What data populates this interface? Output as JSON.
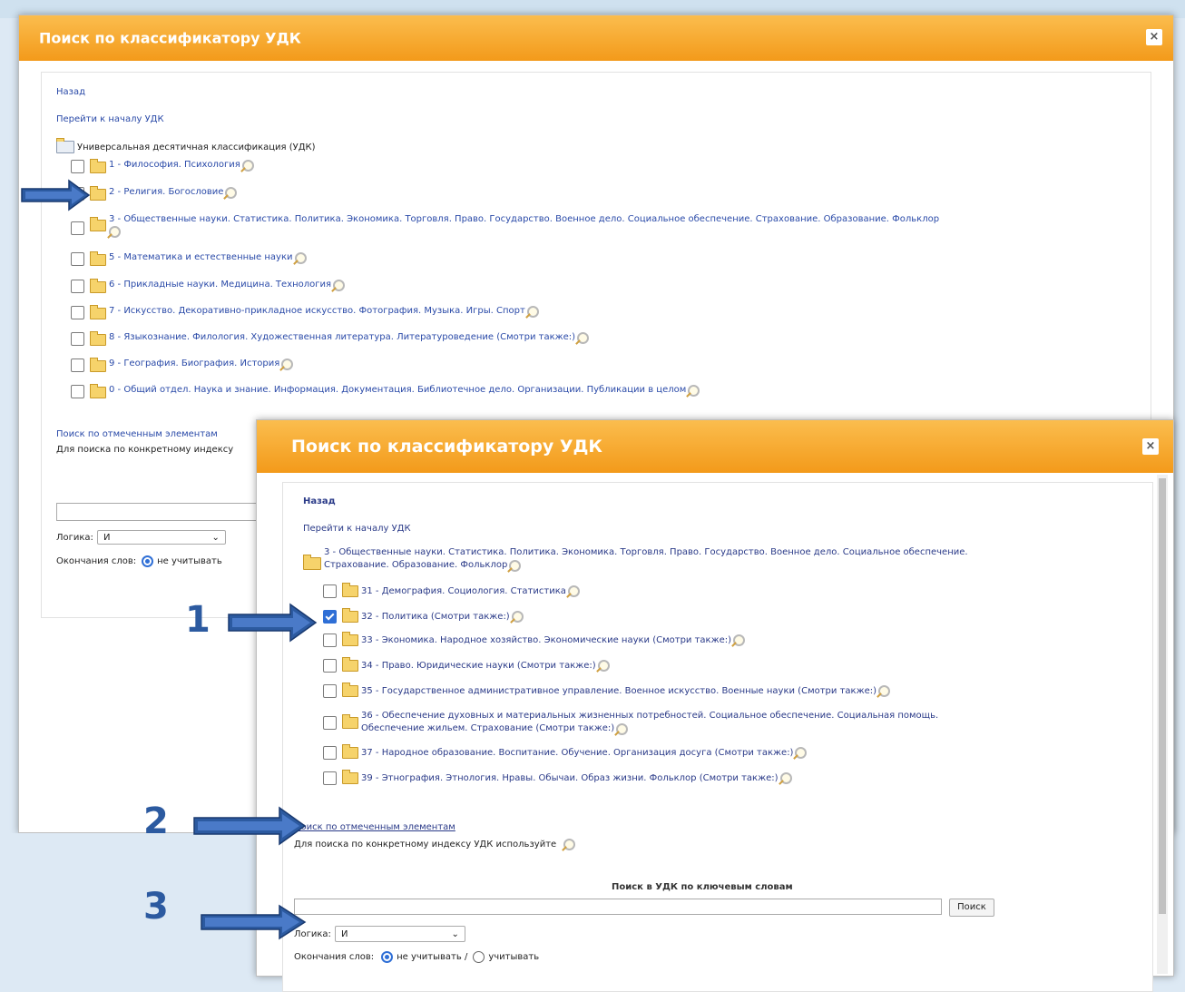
{
  "dialog1": {
    "title": "Поиск по классификатору УДК",
    "close_label": "×",
    "back_link": "Назад",
    "goto_start_link": "Перейти к началу УДК",
    "root_label": "Универсальная десятичная классификация (УДК)",
    "items": [
      {
        "label": "1 - Философия. Психология"
      },
      {
        "label": "2 - Религия. Богословие"
      },
      {
        "label": "3 - Общественные науки. Статистика. Политика. Экономика. Торговля. Право. Государство. Военное дело. Социальное обеспечение. Страхование. Образование. Фольклор"
      },
      {
        "label": "5 - Математика и естественные науки"
      },
      {
        "label": "6 - Прикладные науки. Медицина. Технология"
      },
      {
        "label": "7 - Искусство. Декоративно-прикладное искусство. Фотография. Музыка. Игры. Спорт"
      },
      {
        "label": "8 - Языкознание. Филология. Художественная литература. Литературоведение (Смотри также:)"
      },
      {
        "label": "9 - География. Биография. История"
      },
      {
        "label": "0 - Общий отдел. Наука и знание. Информация. Документация. Библиотечное дело. Организации. Публикации в целом"
      }
    ],
    "search_marked_link": "Поиск по отмеченным элементам",
    "index_hint": "Для поиска по конкретному индексу",
    "logic_label": "Логика:",
    "logic_value": "И",
    "endings_label": "Окончания слов:",
    "endings_option1": "не учитывать"
  },
  "dialog2": {
    "title": "Поиск по классификатору УДК",
    "close_label": "×",
    "back_link": "Назад",
    "goto_start_link": "Перейти к началу УДК",
    "root_label_line1": "3 - Общественные науки. Статистика. Политика. Экономика. Торговля. Право. Государство. Военное дело. Социальное обеспечение.",
    "root_label_line2": "Страхование. Образование. Фольклор",
    "items": [
      {
        "line1": "31 - Демография. Социология. Статистика",
        "line2": "",
        "checked": false
      },
      {
        "line1": "32 - Политика (Смотри также:)",
        "line2": "",
        "checked": true
      },
      {
        "line1": "33 - Экономика. Народное хозяйство. Экономические науки (Смотри также:)",
        "line2": "",
        "checked": false
      },
      {
        "line1": "34 - Право. Юридические науки (Смотри также:)",
        "line2": "",
        "checked": false
      },
      {
        "line1": "35 - Государственное административное управление. Военное искусство. Военные науки (Смотри также:)",
        "line2": "",
        "checked": false
      },
      {
        "line1": "36 - Обеспечение духовных и материальных жизненных потребностей. Социальное обеспечение. Социальная помощь.",
        "line2": "Обеспечение жильем. Страхование (Смотри также:)",
        "checked": false
      },
      {
        "line1": "37 - Народное образование. Воспитание. Обучение. Организация досуга (Смотри также:)",
        "line2": "",
        "checked": false
      },
      {
        "line1": "39 - Этнография. Этнология. Нравы. Обычаи. Образ жизни. Фольклор (Смотри также:)",
        "line2": "",
        "checked": false
      }
    ],
    "search_marked_link": "Поиск по отмеченным элементам",
    "index_hint": "Для поиска по конкретному индексу УДК используйте",
    "keyword_heading": "Поиск в УДК по ключевым словам",
    "search_input_value": "",
    "search_button": "Поиск",
    "logic_label": "Логика:",
    "logic_value": "И",
    "endings_label": "Окончания слов:",
    "endings_option1": "не учитывать /",
    "endings_option2": "учитывать"
  },
  "annotations": {
    "step1": "1",
    "step2": "2",
    "step3": "3"
  },
  "colors": {
    "header_orange": "#f5a323",
    "arrow_blue": "#2c5aa0",
    "link_blue": "#2a4aa8"
  }
}
